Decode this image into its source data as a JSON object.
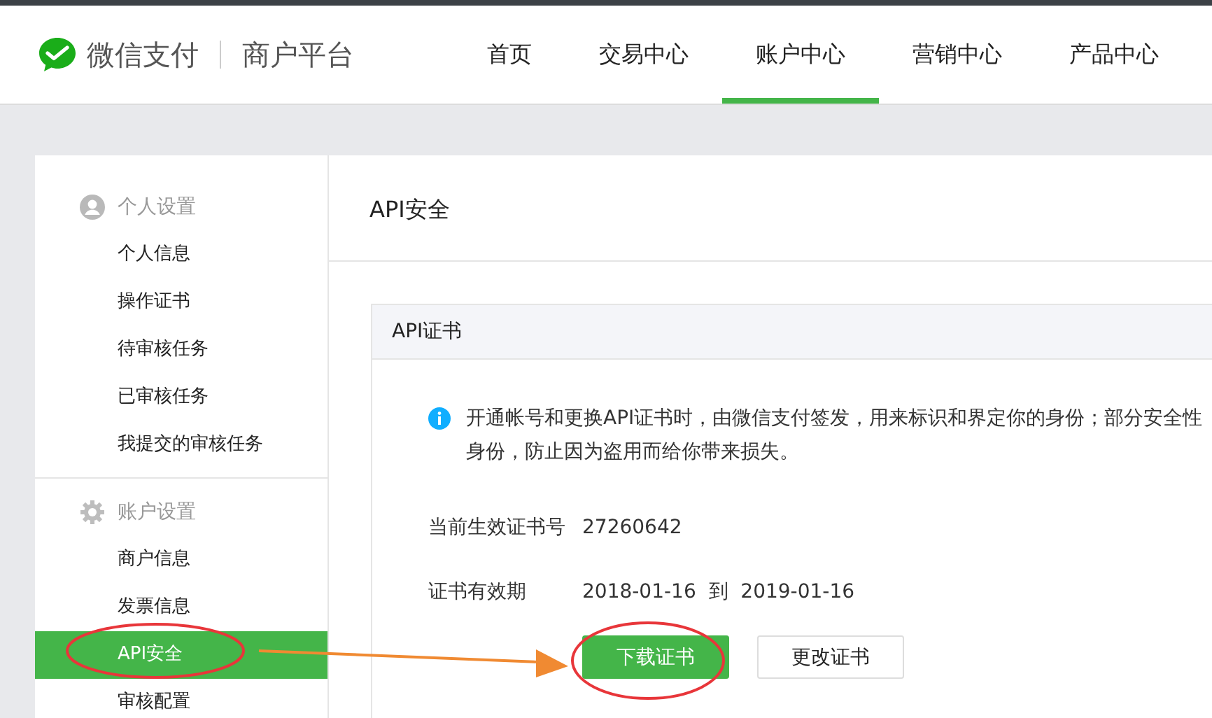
{
  "header": {
    "brand": "微信支付",
    "product": "商户平台",
    "nav": [
      {
        "label": "首页",
        "selected": false
      },
      {
        "label": "交易中心",
        "selected": false
      },
      {
        "label": "账户中心",
        "selected": true
      },
      {
        "label": "营销中心",
        "selected": false
      },
      {
        "label": "产品中心",
        "selected": false
      }
    ]
  },
  "sidebar": {
    "groups": [
      {
        "kind": "person",
        "title": "个人设置",
        "items": [
          {
            "label": "个人信息",
            "selected": false
          },
          {
            "label": "操作证书",
            "selected": false
          },
          {
            "label": "待审核任务",
            "selected": false
          },
          {
            "label": "已审核任务",
            "selected": false
          },
          {
            "label": "我提交的审核任务",
            "selected": false
          }
        ]
      },
      {
        "kind": "gear",
        "title": "账户设置",
        "items": [
          {
            "label": "商户信息",
            "selected": false
          },
          {
            "label": "发票信息",
            "selected": false
          },
          {
            "label": "API安全",
            "selected": true
          },
          {
            "label": "审核配置",
            "selected": false
          }
        ]
      }
    ]
  },
  "content": {
    "title": "API安全",
    "card": {
      "title": "API证书",
      "notice": [
        "开通帐号和更换API证书时，由微信支付签发，用来标识和界定你的身份；部分安全性",
        "身份，防止因为盗用而给你带来损失。"
      ],
      "fields": [
        {
          "label": "当前生效证书号",
          "value": "27260642"
        },
        {
          "label": "证书有效期",
          "value": "2018-01-16  到  2019-01-16"
        }
      ],
      "buttons": [
        {
          "label": "下载证书",
          "kind": "primary"
        },
        {
          "label": "更改证书",
          "kind": "default"
        }
      ]
    }
  },
  "annotations": [
    {
      "kind": "ellipse"
    },
    {
      "kind": "ellipse"
    },
    {
      "kind": "arrow"
    }
  ]
}
